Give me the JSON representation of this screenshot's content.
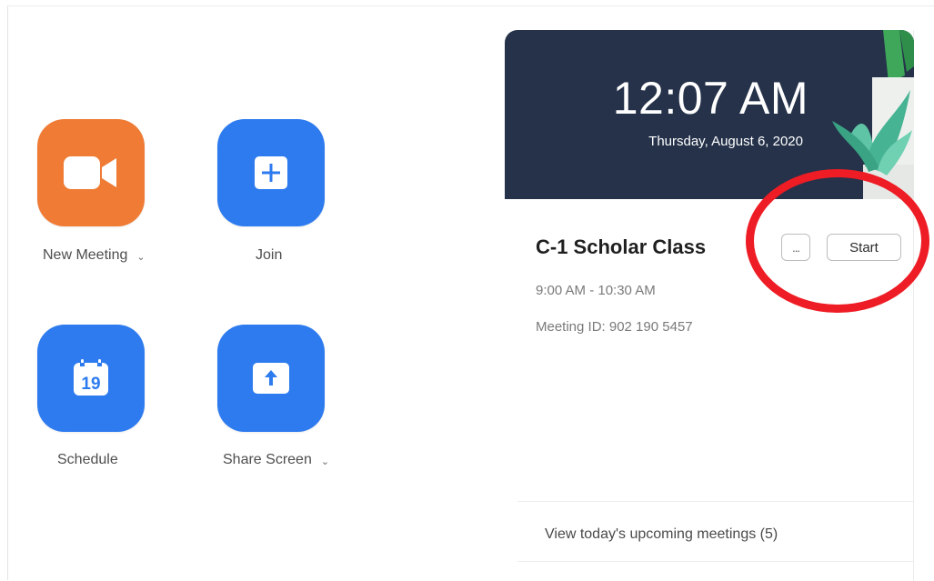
{
  "actions": {
    "new_meeting": {
      "label": "New Meeting",
      "icon": "video-camera-icon",
      "color": "#ef7b34",
      "has_dropdown": true
    },
    "join": {
      "label": "Join",
      "icon": "plus-icon",
      "color": "#2d7bef"
    },
    "schedule": {
      "label": "Schedule",
      "icon": "calendar-icon",
      "calendar_day": "19",
      "color": "#2d7bef"
    },
    "share_screen": {
      "label": "Share Screen",
      "icon": "upload-arrow-icon",
      "color": "#2d7bef",
      "has_dropdown": true
    }
  },
  "banner": {
    "time": "12:07 AM",
    "date": "Thursday, August 6, 2020",
    "background": "#25324a"
  },
  "meeting": {
    "title": "C-1 Scholar Class",
    "more_label": "...",
    "start_label": "Start",
    "time_range": "9:00 AM - 10:30 AM",
    "meeting_id": "Meeting ID: 902 190 5457"
  },
  "footer": {
    "upcoming_link": "View today's upcoming meetings (5)"
  },
  "annotation": {
    "color": "#ee1c24"
  }
}
